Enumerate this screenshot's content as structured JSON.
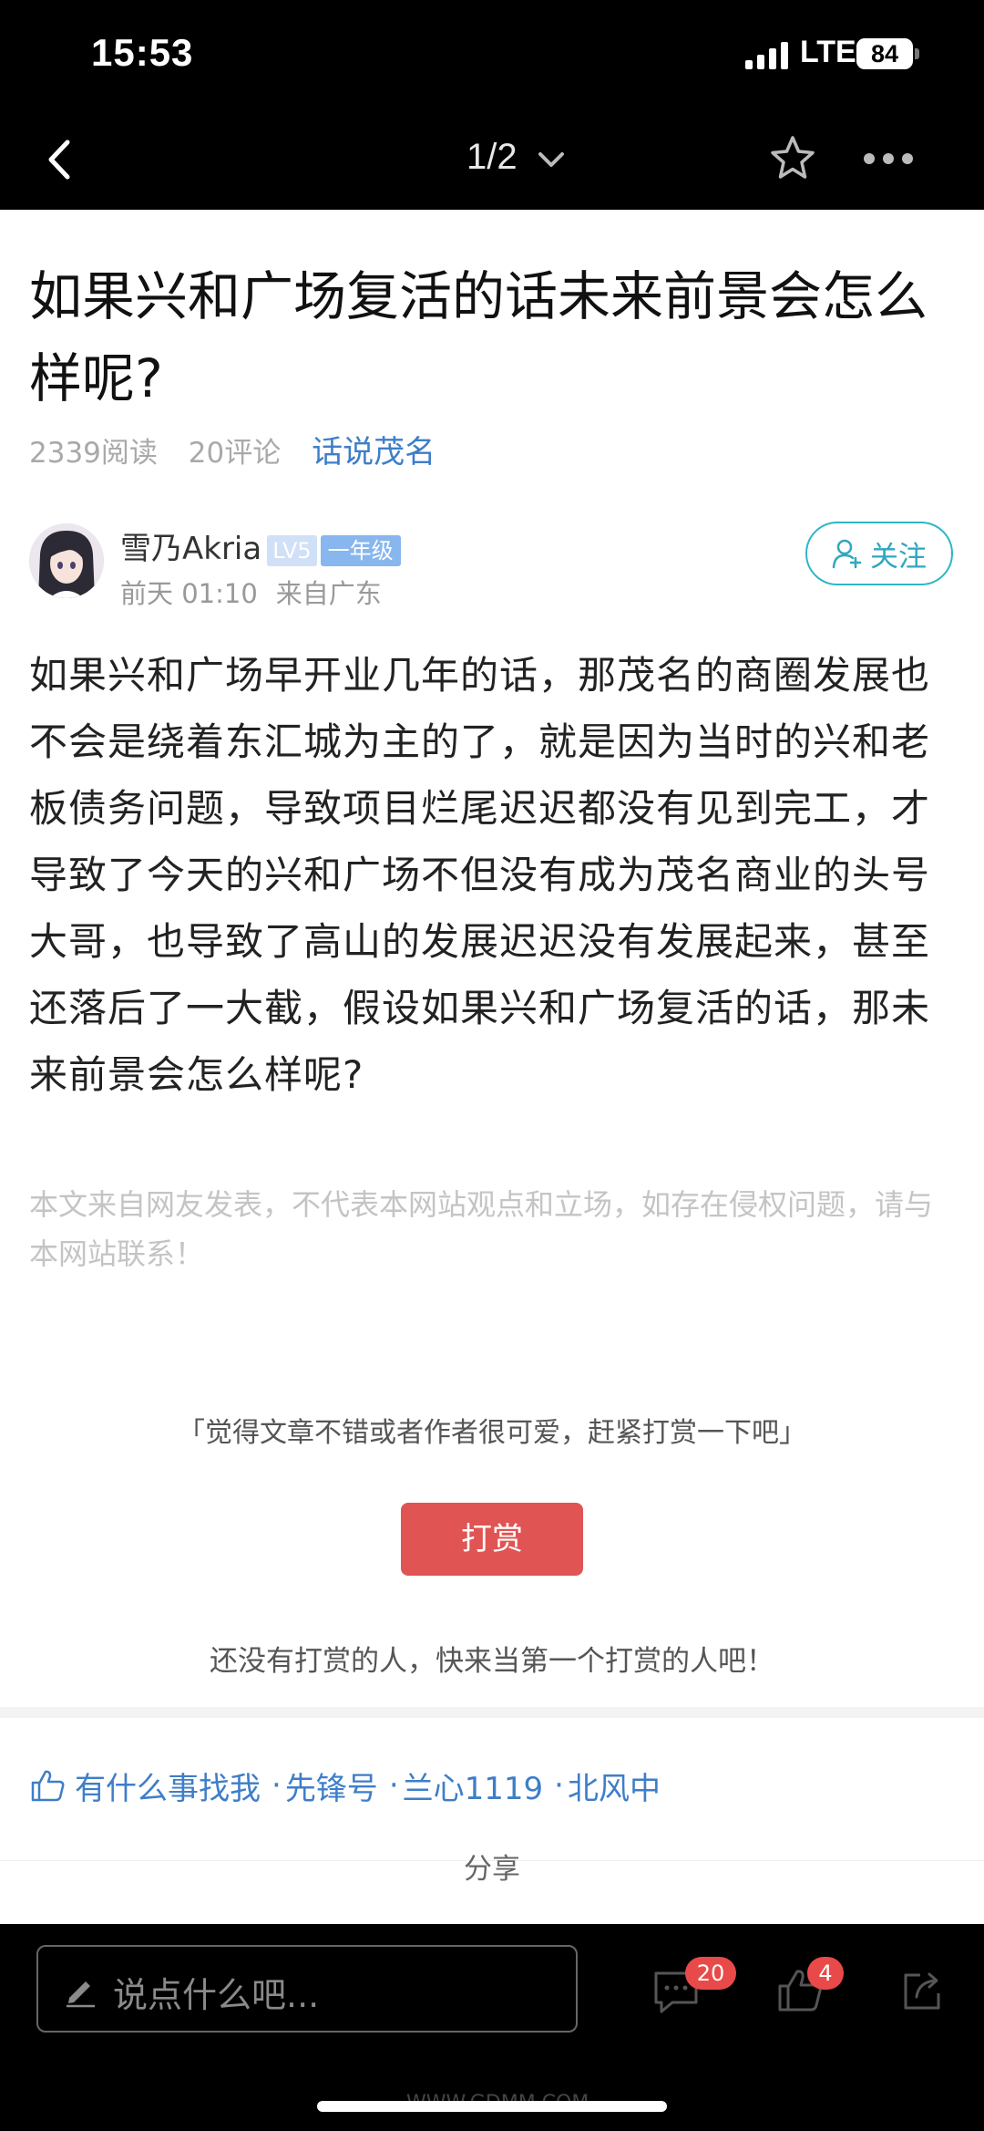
{
  "status_bar": {
    "time": "15:53",
    "network": "LTE",
    "battery": "84"
  },
  "nav": {
    "page_indicator": "1/2"
  },
  "article": {
    "title": "如果兴和广场复活的话未来前景会怎么样呢?",
    "reads": "2339阅读",
    "comments": "20评论",
    "topic": "话说茂名"
  },
  "author": {
    "name": "雪乃Akria",
    "level": "LV5",
    "grade": "一年级",
    "time": "前天 01:10",
    "location": "来自广东",
    "follow_label": "关注"
  },
  "body": "如果兴和广场早开业几年的话，那茂名的商圈发展也不会是绕着东汇城为主的了，就是因为当时的兴和老板债务问题，导致项目烂尾迟迟都没有见到完工，才导致了今天的兴和广场不但没有成为茂名商业的头号大哥，也导致了高山的发展迟迟没有发展起来，甚至还落后了一大截，假设如果兴和广场复活的话，那未来前景会怎么样呢?",
  "disclaimer": "本文来自网友发表，不代表本网站观点和立场，如存在侵权问题，请与本网站联系！",
  "reward": {
    "prompt": "「觉得文章不错或者作者很可爱，赶紧打赏一下吧」",
    "button_label": "打赏",
    "empty_text": "还没有打赏的人，快来当第一个打赏的人吧！"
  },
  "likers": [
    "有什么事找我",
    "先锋号",
    "兰心1119",
    "北风中"
  ],
  "share_label": "分享",
  "bottom": {
    "comment_placeholder": "说点什么吧...",
    "comment_count": "20",
    "like_count": "4"
  },
  "watermark": "WWW.GDMM.COM"
}
